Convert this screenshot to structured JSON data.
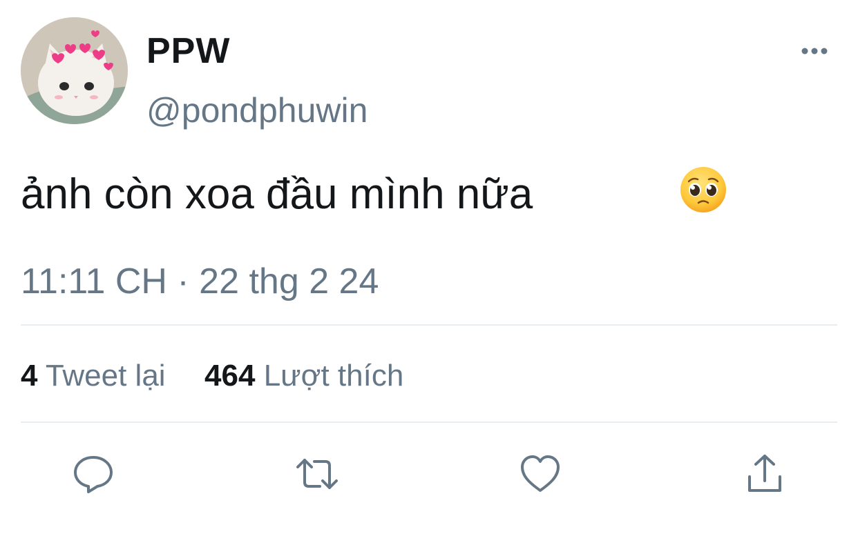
{
  "tweet": {
    "display_name": "PPW",
    "handle": "@pondphuwin",
    "text": "ảnh còn xoa đầu mình nữa",
    "emoji": "pleading-face-icon",
    "timestamp": "11:11 CH · 22 thg 2 24",
    "retweet_count": "4",
    "retweet_label": "Tweet lại",
    "like_count": "464",
    "like_label": "Lượt thích"
  },
  "actions": {
    "reply": "reply-icon",
    "retweet": "retweet-icon",
    "like": "heart-icon",
    "share": "share-icon"
  },
  "colors": {
    "text_primary": "#14171a",
    "text_secondary": "#657786",
    "divider": "#e6ecf0",
    "icon": "#657786"
  }
}
